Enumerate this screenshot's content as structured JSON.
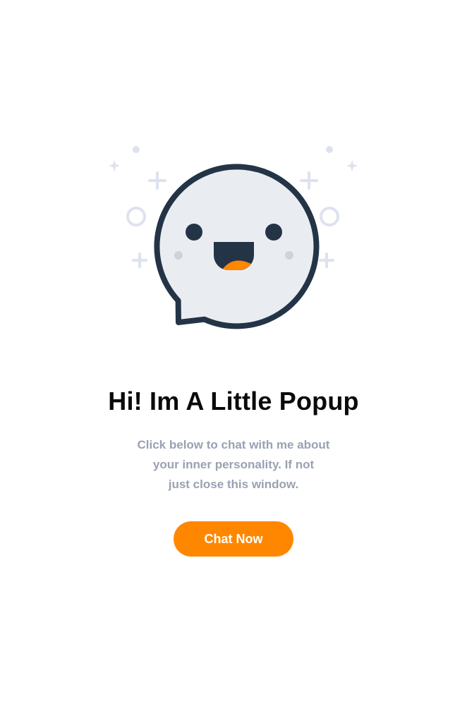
{
  "popup": {
    "headline": "Hi! Im A Little Popup",
    "body_lines": [
      "Click below to chat with me about",
      "your inner personality. If not",
      "just close this window."
    ],
    "cta_label": "Chat Now"
  },
  "illustration": {
    "mascot": "smiling-speech-bubble-icon",
    "decorations": [
      "sparkle-icon",
      "plus-icon",
      "ring-icon",
      "dot-icon"
    ]
  },
  "colors": {
    "accent": "#ff8700",
    "mascot_outline": "#243447",
    "mascot_fill": "#e9edf2",
    "decoration": "#dde2ee",
    "body_text": "#9aa1b2",
    "headline": "#0a0a0a"
  }
}
